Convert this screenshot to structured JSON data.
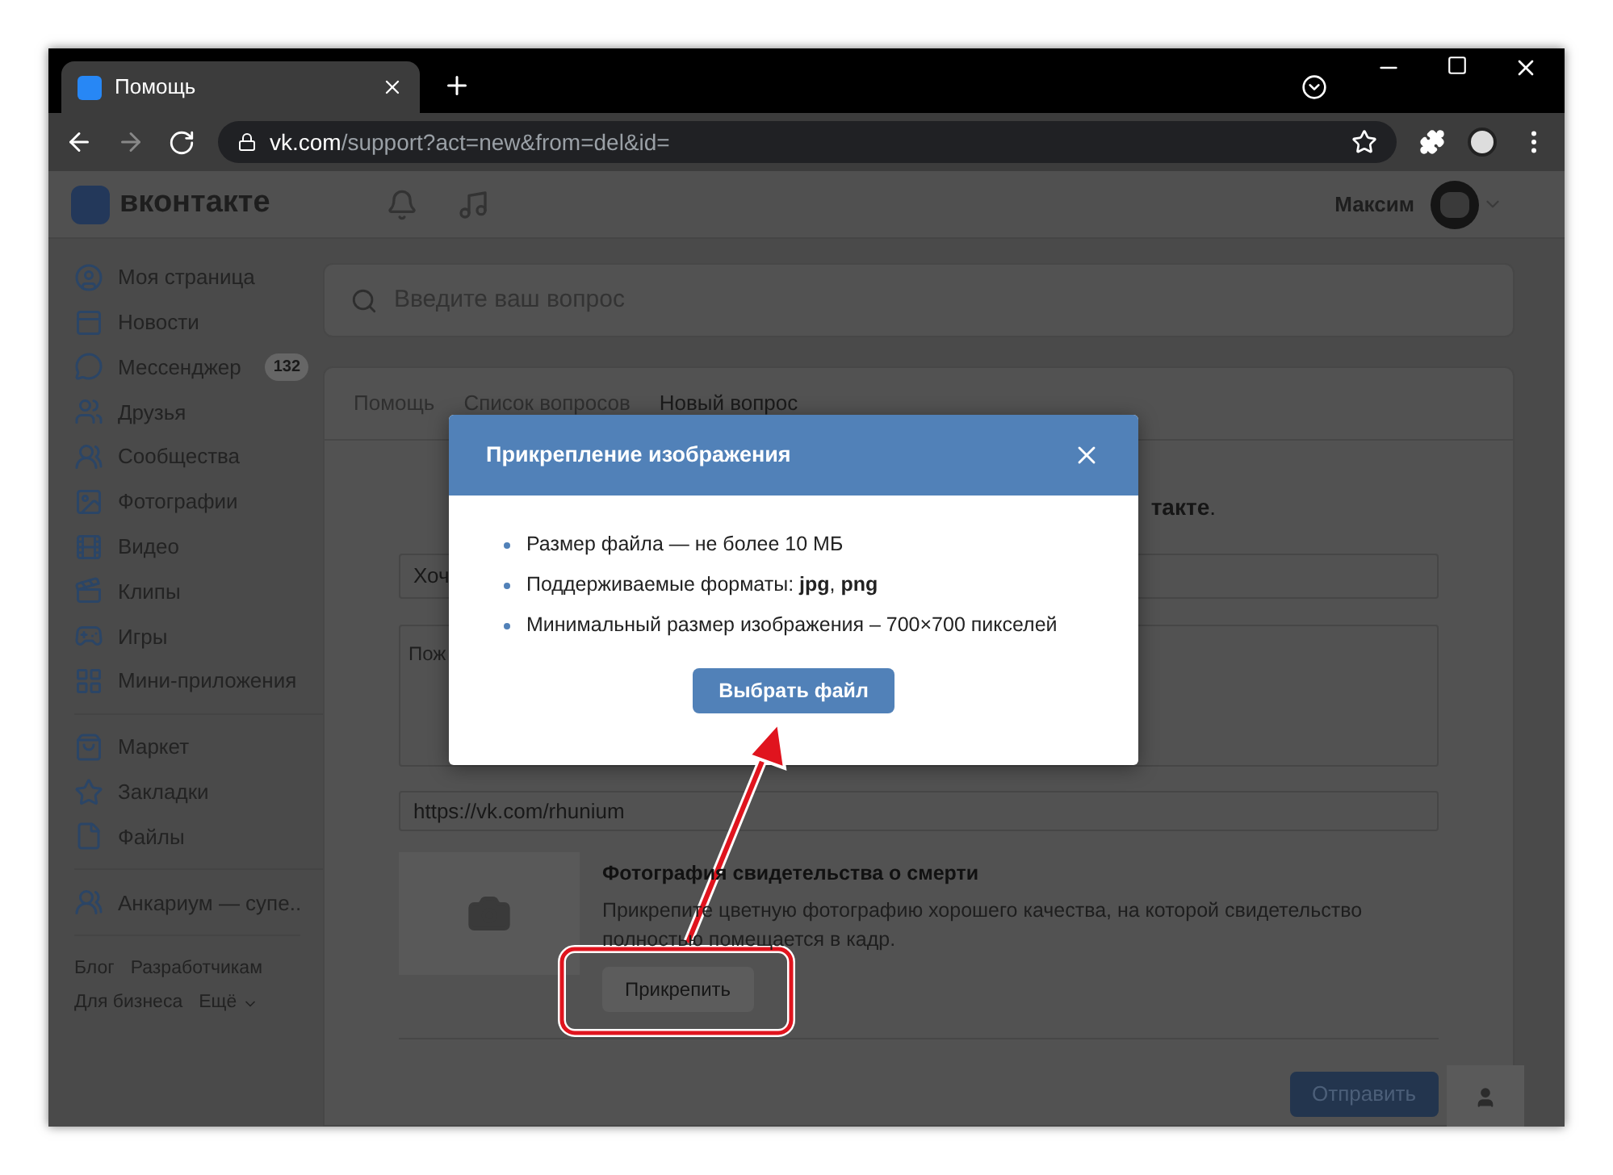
{
  "browser": {
    "tab_title": "Помощь",
    "url_host": "vk.com",
    "url_path": "/support?act=new&from=del&id="
  },
  "header": {
    "logo": "вконтакте",
    "user_name": "Максим"
  },
  "sidebar": {
    "groups": [
      [
        {
          "label": "Моя страница"
        },
        {
          "label": "Новости"
        },
        {
          "label": "Мессенджер",
          "badge": "132"
        },
        {
          "label": "Друзья"
        },
        {
          "label": "Сообщества"
        },
        {
          "label": "Фотографии"
        },
        {
          "label": "Видео"
        },
        {
          "label": "Клипы"
        },
        {
          "label": "Игры"
        },
        {
          "label": "Мини-приложения"
        }
      ],
      [
        {
          "label": "Маркет"
        },
        {
          "label": "Закладки"
        },
        {
          "label": "Файлы"
        }
      ],
      [
        {
          "label": "Анкариум — супе.."
        }
      ]
    ],
    "footer_links": [
      "Блог",
      "Разработчикам",
      "Для бизнеса",
      "Ещё"
    ]
  },
  "search": {
    "placeholder": "Введите ваш вопрос"
  },
  "tabs": [
    {
      "label": "Помощь",
      "selected": false
    },
    {
      "label": "Список вопросов",
      "selected": false
    },
    {
      "label": "Новый вопрос",
      "selected": true
    }
  ],
  "form": {
    "intro": "**такте**.",
    "subject_value": "Хоч",
    "description_placeholder": "Пож",
    "link_value": "https://vk.com/rhunium",
    "attachment": {
      "title": "Фотография свидетельства о смерти",
      "description": "Прикрепите цветную фотографию хорошего качества, на которой свидетельство полностью помещается в кадр.",
      "button": "Прикрепить"
    },
    "submit": "Отправить"
  },
  "modal": {
    "title": "Прикрепление изображения",
    "bullets": [
      "Размер файла — не более 10 МБ",
      "Поддерживаемые форматы: **jpg**, **png**",
      "Минимальный размер изображения – 700×700 пикселей"
    ],
    "button": "Выбрать файл"
  }
}
